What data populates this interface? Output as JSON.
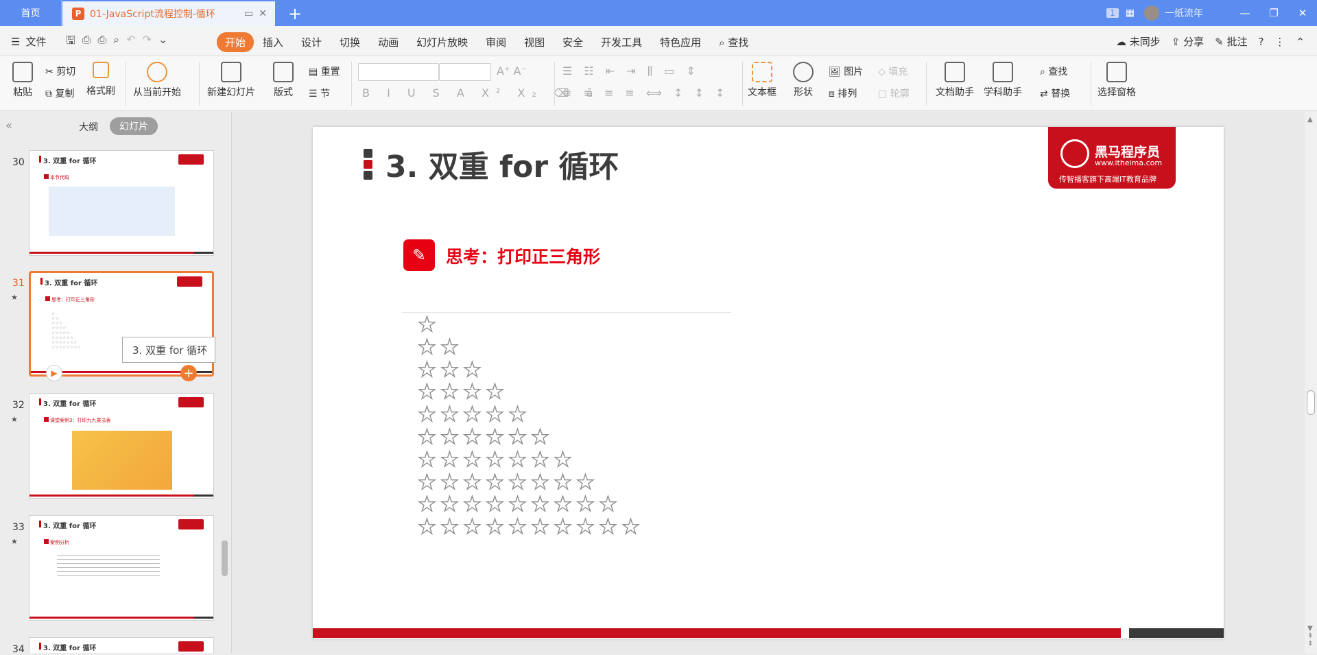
{
  "titlebar": {
    "home_tab": "首页",
    "doc_tab": "01-JavaScript流程控制-循环",
    "page_count": "1",
    "user": "一纸流年"
  },
  "menubar": {
    "file": "文件",
    "tabs": [
      "开始",
      "插入",
      "设计",
      "切换",
      "动画",
      "幻灯片放映",
      "审阅",
      "视图",
      "安全",
      "开发工具",
      "特色应用"
    ],
    "search": "查找",
    "sync": "未同步",
    "share": "分享",
    "comment": "批注"
  },
  "ribbon": {
    "paste": "粘贴",
    "cut": "剪切",
    "copy": "复制",
    "format_painter": "格式刷",
    "from_current": "从当前开始",
    "new_slide": "新建幻灯片",
    "layout": "版式",
    "reset": "重置",
    "section": "节",
    "textbox": "文本框",
    "shape": "形状",
    "picture": "图片",
    "arrange": "排列",
    "fill": "填充",
    "outline": "轮廓",
    "doc_assistant": "文档助手",
    "subject_assistant": "学科助手",
    "find": "查找",
    "replace": "替换",
    "select_pane": "选择窗格"
  },
  "leftpanel": {
    "outline_tab": "大纲",
    "slides_tab": "幻灯片",
    "slides": [
      {
        "num": "30",
        "title": "3. 双重 for 循环",
        "sub": "本节代码"
      },
      {
        "num": "31",
        "title": "3. 双重 for 循环",
        "sub": "思考：打印正三角形"
      },
      {
        "num": "32",
        "title": "3. 双重 for 循环",
        "sub": "课堂案例3：打印九九乘法表"
      },
      {
        "num": "33",
        "title": "3. 双重 for 循环",
        "sub": "案例分析"
      },
      {
        "num": "34",
        "title": "3. 双重 for 循环"
      }
    ],
    "tooltip": "3. 双重 for 循环"
  },
  "slide": {
    "title": "3. 双重 for 循环",
    "logo_name": "黑马程序员",
    "logo_url": "www.itheima.com",
    "logo_slogan": "传智播客旗下高端IT教育品牌",
    "think_label": "思考：打印正三角形",
    "star_rows": 10
  },
  "colors": {
    "accent": "#ef7a33",
    "brand_red": "#c8101c",
    "titlebar": "#5b8df0"
  }
}
